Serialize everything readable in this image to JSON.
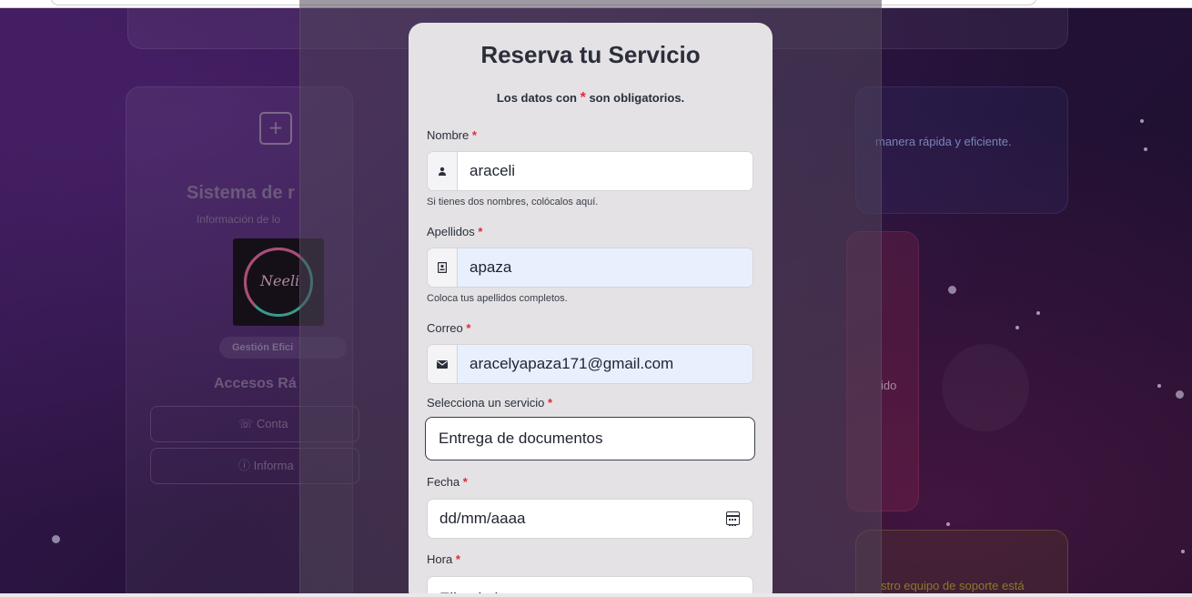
{
  "background": {
    "left_card": {
      "title": "Sistema de r",
      "subtitle": "Información de lo",
      "logo_text": "Neeli",
      "badge": "Gestión Efici",
      "section_title": "Accesos Rá",
      "buttons": [
        {
          "label": "Conta",
          "icon": "phone-icon"
        },
        {
          "label": "Informa",
          "icon": "info-icon"
        }
      ]
    },
    "right_blue_text": "manera rápida y eficiente.",
    "right_red_text": "ido",
    "right_yellow_text": "stro equipo de soporte está"
  },
  "modal": {
    "title": "Reserva tu Servicio",
    "required_note_prefix": "Los datos con",
    "required_note_star": "*",
    "required_note_suffix": "son obligatorios.",
    "required_marker": "*",
    "fields": {
      "nombre": {
        "label": "Nombre",
        "value": "araceli",
        "icon": "user-icon",
        "help": "Si tienes dos nombres, colócalos aquí."
      },
      "apellidos": {
        "label": "Apellidos",
        "value": "apaza",
        "icon": "id-card-icon",
        "help": "Coloca tus apellidos completos."
      },
      "correo": {
        "label": "Correo",
        "value": "aracelyapaza171@gmail.com",
        "icon": "envelope-icon"
      },
      "servicio": {
        "label": "Selecciona un servicio",
        "value": "Entrega de documentos"
      },
      "fecha": {
        "label": "Fecha",
        "value": "dd/mm/aaaa",
        "icon": "calendar-icon"
      },
      "hora": {
        "label": "Hora",
        "value": "Elige la hora"
      }
    }
  },
  "colors": {
    "accent_required": "#e02a3a",
    "text_dark": "#2b2f3a",
    "autofill_bg": "#e8f0fe",
    "modal_bg": "#e4e2e5"
  }
}
